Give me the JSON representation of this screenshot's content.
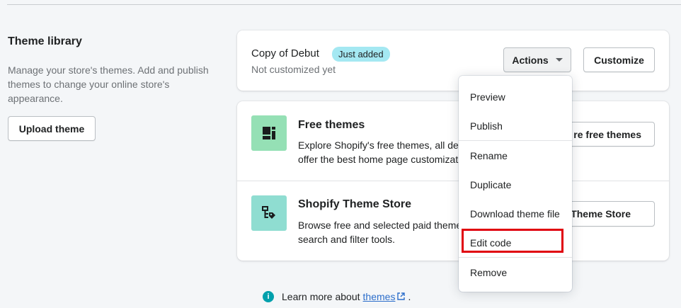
{
  "library": {
    "title": "Theme library",
    "description": "Manage your store's themes. Add and publish themes to change your online store's appearance.",
    "upload_button": "Upload theme"
  },
  "theme": {
    "name": "Copy of Debut",
    "badge": "Just added",
    "status": "Not customized yet",
    "actions_button": "Actions",
    "customize_button": "Customize"
  },
  "free_themes": {
    "title": "Free themes",
    "description_line1": "Explore Shopify's free themes, all des",
    "description_line2": "offer the best home page customizati",
    "button": "re free themes"
  },
  "theme_store": {
    "title": "Shopify Theme Store",
    "description_line1": "Browse free and selected paid theme",
    "description_line2": "search and filter tools.",
    "button": "Theme Store"
  },
  "menu": {
    "items": [
      "Preview",
      "Publish",
      "Rename",
      "Duplicate",
      "Download theme file",
      "Edit code",
      "Remove"
    ],
    "highlighted": "Edit code"
  },
  "footer": {
    "learn_prefix": "Learn more about",
    "learn_link": "themes",
    "learn_suffix": "."
  },
  "colors": {
    "badge": "#a4e8f2",
    "free_tile": "#95e0b5",
    "store_tile": "#8fddd1",
    "highlight": "#e0000d",
    "link": "#2c6ecb",
    "info": "#00a0ac"
  },
  "icons": [
    "layout-icon",
    "theme-store-icon",
    "caret-down-icon",
    "info-icon",
    "external-link-icon"
  ]
}
